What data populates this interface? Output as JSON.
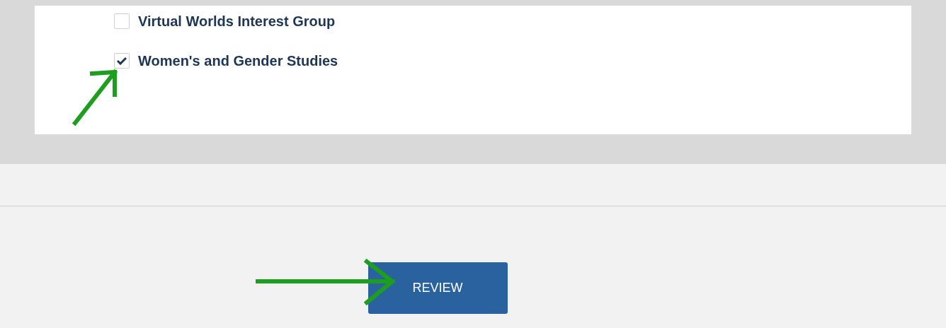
{
  "options": [
    {
      "label": "Virtual Worlds Interest Group",
      "checked": false
    },
    {
      "label": "Women's and Gender Studies",
      "checked": true
    }
  ],
  "button": {
    "label": "REVIEW"
  }
}
